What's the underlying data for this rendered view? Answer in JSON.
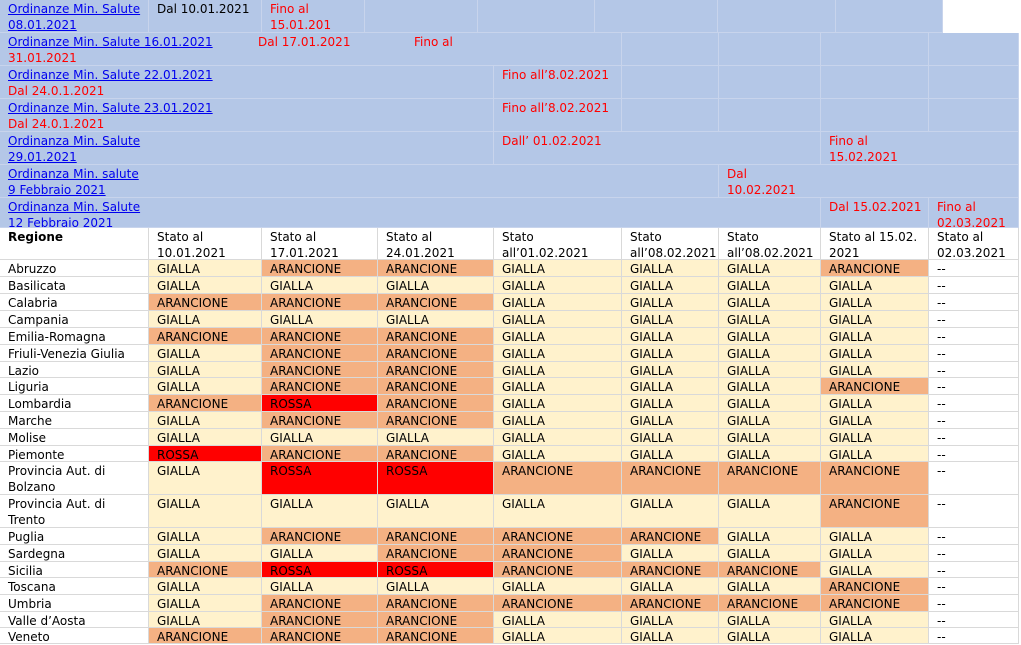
{
  "ordinances": [
    {
      "link": [
        "Ordinanze Min. Salute",
        "08.01.2021"
      ],
      "from": "Dal 10.01.2021",
      "to": [
        "Fino al",
        "15.01.201"
      ]
    },
    {
      "link": [
        "Ordinanze Min. Salute 16.01.2021"
      ],
      "from": "Dal 17.01.2021",
      "to": [
        "Fino al"
      ],
      "extra": "31.01.2021"
    },
    {
      "link": [
        "Ordinanze Min. Salute 22.01.2021"
      ],
      "from2": "Dal 24.0.1.2021",
      "to": [
        "Fino all’8.02.2021"
      ]
    },
    {
      "link": [
        "Ordinanze Min. Salute 23.01.2021"
      ],
      "from2": "Dal 24.0.1.2021",
      "to": [
        "Fino all’8.02.2021"
      ]
    },
    {
      "link": [
        "Ordinanza Min. Salute",
        "29.01.2021"
      ],
      "from": "Dall’ 01.02.2021",
      "to": [
        "Fino al",
        "15.02.2021"
      ]
    },
    {
      "link": [
        "Ordinanza Min. salute",
        "9 Febbraio 2021"
      ],
      "from": [
        "Dal",
        "10.02.2021"
      ]
    },
    {
      "link": [
        "Ordinanza Min. Salute",
        "12 Febbraio 2021"
      ],
      "from": "Dal 15.02.2021",
      "to": [
        "Fino al",
        "02.03.2021"
      ]
    }
  ],
  "table": {
    "headers": [
      [
        "Regione"
      ],
      [
        "Stato al",
        "10.01.2021"
      ],
      [
        "Stato al",
        "17.01.2021"
      ],
      [
        "Stato al",
        "24.01.2021"
      ],
      [
        "Stato",
        "all’01.02.2021"
      ],
      [
        "Stato",
        "all’08.02.2021"
      ],
      [
        "Stato",
        "all’08.02.2021"
      ],
      [
        "Stato al 15.02.",
        "2021"
      ],
      [
        "Stato al",
        "02.03.2021"
      ]
    ],
    "rows": [
      {
        "region": [
          "Abruzzo"
        ],
        "values": [
          "GIALLA",
          "ARANCIONE",
          "ARANCIONE",
          "GIALLA",
          "GIALLA",
          "GIALLA",
          "ARANCIONE",
          "--"
        ]
      },
      {
        "region": [
          "Basilicata"
        ],
        "values": [
          "GIALLA",
          "GIALLA",
          "GIALLA",
          "GIALLA",
          "GIALLA",
          "GIALLA",
          "GIALLA",
          "--"
        ]
      },
      {
        "region": [
          "Calabria"
        ],
        "values": [
          "ARANCIONE",
          "ARANCIONE",
          "ARANCIONE",
          "GIALLA",
          "GIALLA",
          "GIALLA",
          "GIALLA",
          "--"
        ]
      },
      {
        "region": [
          "Campania"
        ],
        "values": [
          "GIALLA",
          "GIALLA",
          "GIALLA",
          "GIALLA",
          "GIALLA",
          "GIALLA",
          "GIALLA",
          "--"
        ]
      },
      {
        "region": [
          "Emilia-Romagna"
        ],
        "values": [
          "ARANCIONE",
          "ARANCIONE",
          "ARANCIONE",
          "GIALLA",
          "GIALLA",
          "GIALLA",
          "GIALLA",
          "--"
        ]
      },
      {
        "region": [
          "Friuli-Venezia Giulia"
        ],
        "values": [
          "GIALLA",
          "ARANCIONE",
          "ARANCIONE",
          "GIALLA",
          "GIALLA",
          "GIALLA",
          "GIALLA",
          "--"
        ]
      },
      {
        "region": [
          "Lazio"
        ],
        "values": [
          "GIALLA",
          "ARANCIONE",
          "ARANCIONE",
          "GIALLA",
          "GIALLA",
          "GIALLA",
          "GIALLA",
          "--"
        ]
      },
      {
        "region": [
          "Liguria"
        ],
        "values": [
          "GIALLA",
          "ARANCIONE",
          "ARANCIONE",
          "GIALLA",
          "GIALLA",
          "GIALLA",
          "ARANCIONE",
          "--"
        ]
      },
      {
        "region": [
          "Lombardia"
        ],
        "values": [
          "ARANCIONE",
          "ROSSA",
          "ARANCIONE",
          "GIALLA",
          "GIALLA",
          "GIALLA",
          "GIALLA",
          "--"
        ]
      },
      {
        "region": [
          "Marche"
        ],
        "values": [
          "GIALLA",
          "ARANCIONE",
          "ARANCIONE",
          "GIALLA",
          "GIALLA",
          "GIALLA",
          "GIALLA",
          "--"
        ]
      },
      {
        "region": [
          "Molise"
        ],
        "values": [
          "GIALLA",
          "GIALLA",
          "GIALLA",
          "GIALLA",
          "GIALLA",
          "GIALLA",
          "GIALLA",
          "--"
        ]
      },
      {
        "region": [
          "Piemonte"
        ],
        "values": [
          "ROSSA",
          "ARANCIONE",
          "ARANCIONE",
          "GIALLA",
          "GIALLA",
          "GIALLA",
          "GIALLA",
          "--"
        ]
      },
      {
        "region": [
          "Provincia Aut. di",
          "Bolzano"
        ],
        "values": [
          "GIALLA",
          "ROSSA",
          "ROSSA",
          "ARANCIONE",
          "ARANCIONE",
          "ARANCIONE",
          "ARANCIONE",
          "--"
        ]
      },
      {
        "region": [
          "Provincia Aut. di",
          "Trento"
        ],
        "values": [
          "GIALLA",
          "GIALLA",
          "GIALLA",
          "GIALLA",
          "GIALLA",
          "GIALLA",
          "ARANCIONE",
          "--"
        ]
      },
      {
        "region": [
          "Puglia"
        ],
        "values": [
          "GIALLA",
          "ARANCIONE",
          "ARANCIONE",
          "ARANCIONE",
          "ARANCIONE",
          "GIALLA",
          "GIALLA",
          "--"
        ]
      },
      {
        "region": [
          "Sardegna"
        ],
        "values": [
          "GIALLA",
          "GIALLA",
          "ARANCIONE",
          "ARANCIONE",
          "GIALLA",
          "GIALLA",
          "GIALLA",
          "--"
        ]
      },
      {
        "region": [
          "Sicilia"
        ],
        "values": [
          "ARANCIONE",
          "ROSSA",
          "ROSSA",
          "ARANCIONE",
          "ARANCIONE",
          "ARANCIONE",
          "GIALLA",
          "--"
        ]
      },
      {
        "region": [
          "Toscana"
        ],
        "values": [
          "GIALLA",
          "GIALLA",
          "GIALLA",
          "GIALLA",
          "GIALLA",
          "GIALLA",
          "ARANCIONE",
          "--"
        ]
      },
      {
        "region": [
          "Umbria"
        ],
        "values": [
          "GIALLA",
          "ARANCIONE",
          "ARANCIONE",
          "ARANCIONE",
          "ARANCIONE",
          "ARANCIONE",
          "ARANCIONE",
          "--"
        ]
      },
      {
        "region": [
          "Valle d’Aosta"
        ],
        "values": [
          "GIALLA",
          "ARANCIONE",
          "ARANCIONE",
          "GIALLA",
          "GIALLA",
          "GIALLA",
          "GIALLA",
          "--"
        ]
      },
      {
        "region": [
          "Veneto"
        ],
        "values": [
          "ARANCIONE",
          "ARANCIONE",
          "ARANCIONE",
          "GIALLA",
          "GIALLA",
          "GIALLA",
          "GIALLA",
          "--"
        ]
      }
    ]
  },
  "colors": {
    "GIALLA": "#fff2cc",
    "ARANCIONE": "#f4b183",
    "ROSSA": "#ff0000",
    "--": "#ffffff"
  }
}
